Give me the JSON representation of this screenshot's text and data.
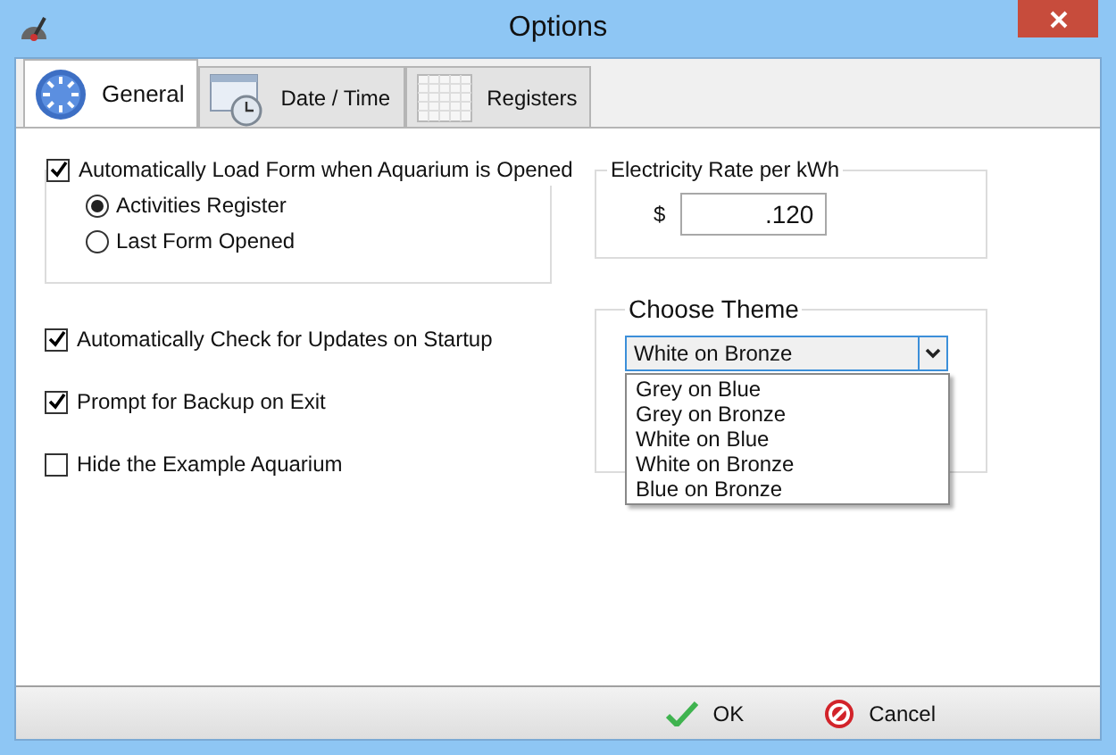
{
  "window": {
    "title": "Options"
  },
  "tabs": [
    {
      "label": "General",
      "selected": true
    },
    {
      "label": "Date / Time",
      "selected": false
    },
    {
      "label": "Registers",
      "selected": false
    }
  ],
  "auto_load": {
    "label": "Automatically Load Form when Aquarium is Opened",
    "checked": true,
    "options": [
      {
        "label": "Activities Register",
        "selected": true
      },
      {
        "label": "Last Form Opened",
        "selected": false
      }
    ]
  },
  "checkboxes": [
    {
      "label": "Automatically Check for Updates on Startup",
      "checked": true
    },
    {
      "label": "Prompt for Backup on Exit",
      "checked": true
    },
    {
      "label": "Hide the Example Aquarium",
      "checked": false
    }
  ],
  "electricity": {
    "title": "Electricity Rate per kWh",
    "currency": "$",
    "value": ".120"
  },
  "theme": {
    "title": "Choose Theme",
    "value": "White on Bronze",
    "expanded": true,
    "options": [
      "Grey on Blue",
      "Grey on Bronze",
      "White on Blue",
      "White on Bronze",
      "Blue on Bronze"
    ]
  },
  "buttons": [
    {
      "label": "OK",
      "kind": "ok"
    },
    {
      "label": "Cancel",
      "kind": "cancel"
    }
  ]
}
